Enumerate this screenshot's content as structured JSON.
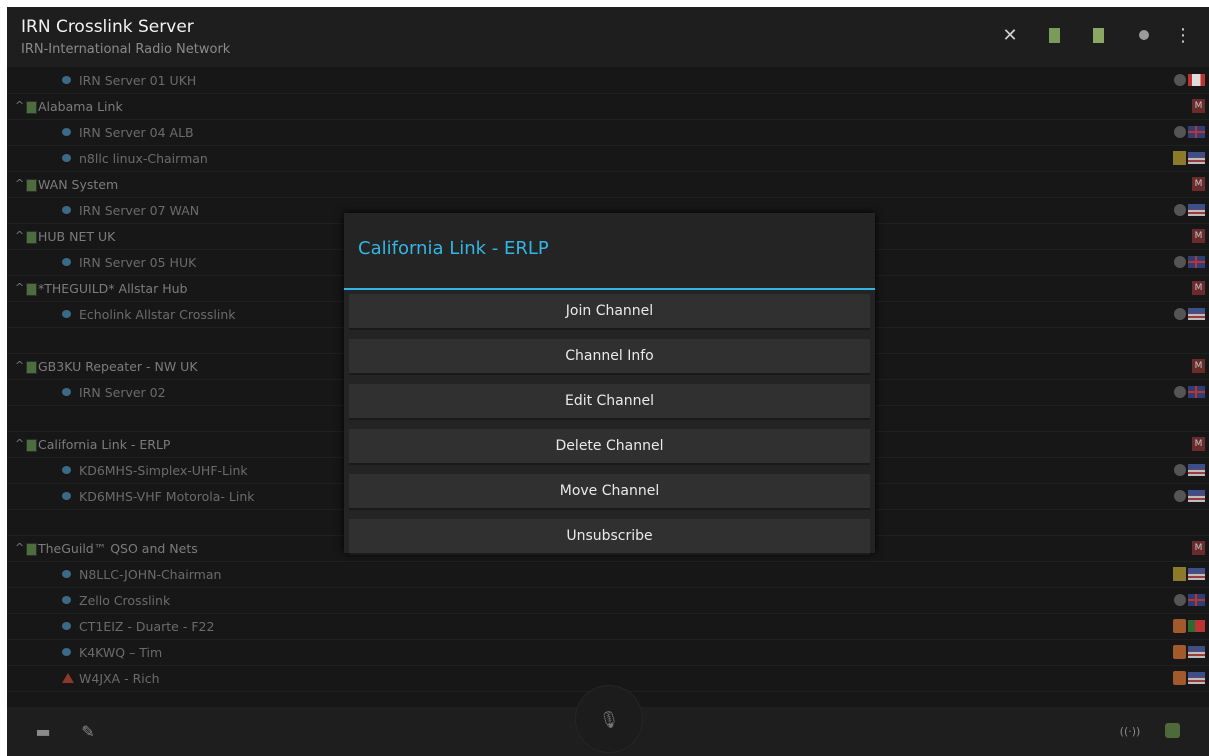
{
  "app": {
    "title": "IRN Crosslink Server",
    "subtitle": "IRN-International Radio Network"
  },
  "toolbar_icons": [
    "tools-icon",
    "channel-list-icon",
    "channel-add-icon",
    "status-icon",
    "overflow-menu-icon"
  ],
  "channels": [
    {
      "type": "server",
      "name": "IRN Server 01 UKH",
      "badges": [
        "dot",
        "ca"
      ]
    },
    {
      "type": "group",
      "name": "Alabama Link",
      "badges": [
        "m"
      ]
    },
    {
      "type": "server",
      "name": "IRN Server 04 ALB",
      "badges": [
        "dot",
        "uk"
      ]
    },
    {
      "type": "server",
      "name": "n8llc linux-Chairman",
      "badges": [
        "n",
        "us"
      ]
    },
    {
      "type": "group",
      "name": "WAN System",
      "badges": [
        "m"
      ]
    },
    {
      "type": "server",
      "name": "IRN Server 07 WAN",
      "badges": [
        "dot",
        "us"
      ]
    },
    {
      "type": "group",
      "name": "HUB NET UK",
      "badges": [
        "m"
      ]
    },
    {
      "type": "server",
      "name": "IRN Server 05 HUK",
      "badges": [
        "dot",
        "uk"
      ]
    },
    {
      "type": "group",
      "name": "*THEGUILD* Allstar Hub",
      "badges": [
        "m"
      ]
    },
    {
      "type": "server",
      "name": "Echolink Allstar Crosslink",
      "badges": [
        "dot",
        "us"
      ]
    },
    {
      "type": "blank",
      "name": "",
      "badges": []
    },
    {
      "type": "group",
      "name": "GB3KU Repeater - NW UK",
      "badges": [
        "m"
      ]
    },
    {
      "type": "server",
      "name": "IRN Server 02",
      "badges": [
        "dot",
        "uk"
      ]
    },
    {
      "type": "blank",
      "name": "",
      "badges": []
    },
    {
      "type": "group",
      "name": "California Link - ERLP",
      "badges": [
        "m"
      ]
    },
    {
      "type": "server",
      "name": "KD6MHS-Simplex-UHF-Link",
      "badges": [
        "dot",
        "us"
      ]
    },
    {
      "type": "server",
      "name": "KD6MHS-VHF Motorola- Link",
      "badges": [
        "dot",
        "us"
      ]
    },
    {
      "type": "blank",
      "name": "",
      "badges": []
    },
    {
      "type": "group",
      "name": "TheGuild™ QSO and Nets",
      "badges": [
        "m"
      ]
    },
    {
      "type": "server",
      "name": "N8LLC-JOHN-Chairman",
      "badges": [
        "n",
        "us"
      ]
    },
    {
      "type": "server",
      "name": "Zello Crosslink",
      "badges": [
        "dot",
        "uk"
      ]
    },
    {
      "type": "server",
      "name": "CT1EIZ - Duarte - F22",
      "badges": [
        "g",
        "pt"
      ]
    },
    {
      "type": "server",
      "name": "K4KWQ – Tim",
      "badges": [
        "g",
        "us"
      ]
    },
    {
      "type": "server",
      "warn": true,
      "name": "W4JXA - Rich",
      "badges": [
        "g",
        "us"
      ]
    }
  ],
  "dialog": {
    "title": "California Link - ERLP",
    "buttons": [
      "Join Channel",
      "Channel Info",
      "Edit Channel",
      "Delete Channel",
      "Move Channel",
      "Unsubscribe"
    ]
  },
  "bottom_icons": [
    "chat-icon",
    "pencil-icon",
    "mic-icon",
    "signal-icon",
    "settings-icon"
  ],
  "colors": {
    "accent": "#33b5e5",
    "background": "#171717"
  }
}
